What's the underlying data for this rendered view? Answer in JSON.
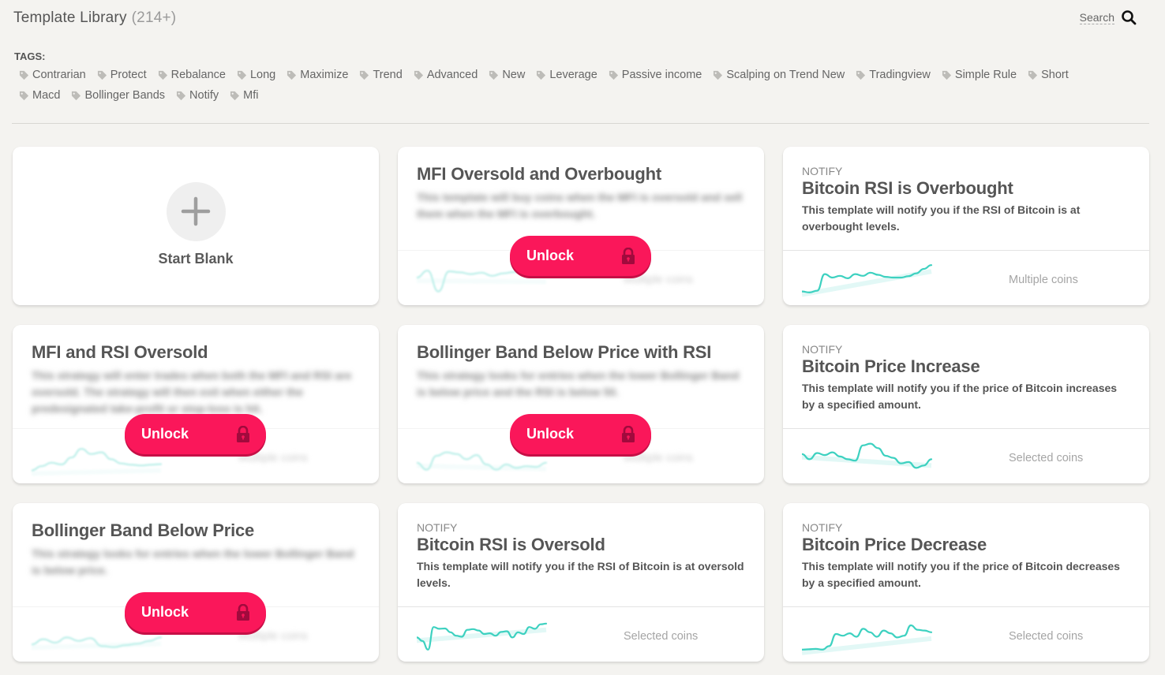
{
  "header": {
    "title": "Template Library",
    "count": "(214+)",
    "search_label": "Search"
  },
  "tags": {
    "label": "TAGS:",
    "items": [
      "Contrarian",
      "Protect",
      "Rebalance",
      "Long",
      "Maximize",
      "Trend",
      "Advanced",
      "New",
      "Leverage",
      "Passive income",
      "Scalping on Trend New",
      "Tradingview",
      "Simple Rule",
      "Short",
      "Macd",
      "Bollinger Bands",
      "Notify",
      "Mfi"
    ]
  },
  "colors": {
    "accent": "#fa175a",
    "spark": "#3dd1c0",
    "background": "#f4f3f0"
  },
  "start_blank": {
    "label": "Start Blank"
  },
  "unlock_label": "Unlock",
  "cards": [
    {
      "title": "MFI Oversold and Overbought",
      "description": "This template will buy coins when the MFI is oversold and sell them when the MFI is overbought.",
      "coins": "Multiple coins",
      "locked": true,
      "spark": [
        50,
        30,
        90,
        32,
        35,
        40,
        36,
        45,
        38,
        34,
        30,
        33,
        44
      ]
    },
    {
      "eyebrow": "NOTIFY",
      "title": "Bitcoin RSI is Overbought",
      "description": "This template will notify you if the RSI of Bitcoin is at overbought levels.",
      "coins": "Multiple coins",
      "locked": false,
      "spark": [
        90,
        93,
        88,
        40,
        50,
        45,
        52,
        40,
        45,
        36,
        42,
        48,
        50,
        50,
        46,
        38,
        25,
        14
      ]
    },
    {
      "title": "MFI and RSI Oversold",
      "description": "This strategy will enter trades when both the MFI and RSI are oversold. The strategy will then exit when either the predesignated take-profit or stop-loss is hit.",
      "coins": "Multiple coins",
      "locked": true,
      "spark": [
        92,
        80,
        70,
        75,
        55,
        30,
        45,
        40,
        60,
        72,
        76,
        78,
        76,
        74
      ]
    },
    {
      "title": "Bollinger Band Below Price with RSI",
      "description": "This strategy looks for entries when the lower Bollinger Band is below price and the RSI is below 50.",
      "coins": "Multiple coins",
      "locked": true,
      "spark": [
        70,
        90,
        50,
        40,
        45,
        60,
        48,
        75,
        90,
        75,
        85,
        80,
        82,
        70
      ]
    },
    {
      "eyebrow": "NOTIFY",
      "title": "Bitcoin Price Increase",
      "description": "This template will notify you if the price of Bitcoin increases by a specified amount.",
      "coins": "Selected coins",
      "locked": false,
      "spark": [
        45,
        60,
        42,
        48,
        40,
        52,
        60,
        64,
        20,
        15,
        28,
        50,
        56,
        72,
        68,
        85,
        78,
        60
      ]
    },
    {
      "title": "Bollinger Band Below Price",
      "description": "This strategy looks for entries when the lower Bollinger Band is below price.",
      "coins": "Multiple coins",
      "locked": true,
      "spark": [
        80,
        65,
        75,
        60,
        70,
        62,
        85,
        88,
        82,
        78,
        70,
        60
      ]
    },
    {
      "eyebrow": "NOTIFY",
      "title": "Bitcoin RSI is Oversold",
      "description": "This template will notify you if the RSI of Bitcoin is at oversold levels.",
      "coins": "Selected coins",
      "locked": false,
      "spark": [
        60,
        70,
        95,
        30,
        35,
        34,
        45,
        55,
        58,
        38,
        36,
        40,
        50,
        48,
        55,
        44,
        42,
        60,
        45,
        50,
        30,
        35,
        22,
        20
      ]
    },
    {
      "eyebrow": "NOTIFY",
      "title": "Bitcoin Price Decrease",
      "description": "This template will notify you if the price of Bitcoin decreases by a specified amount.",
      "coins": "Selected coins",
      "locked": false,
      "spark": [
        95,
        94,
        93,
        95,
        85,
        50,
        55,
        48,
        58,
        35,
        45,
        58,
        40,
        48,
        60,
        55,
        25,
        38,
        40,
        45
      ]
    }
  ]
}
